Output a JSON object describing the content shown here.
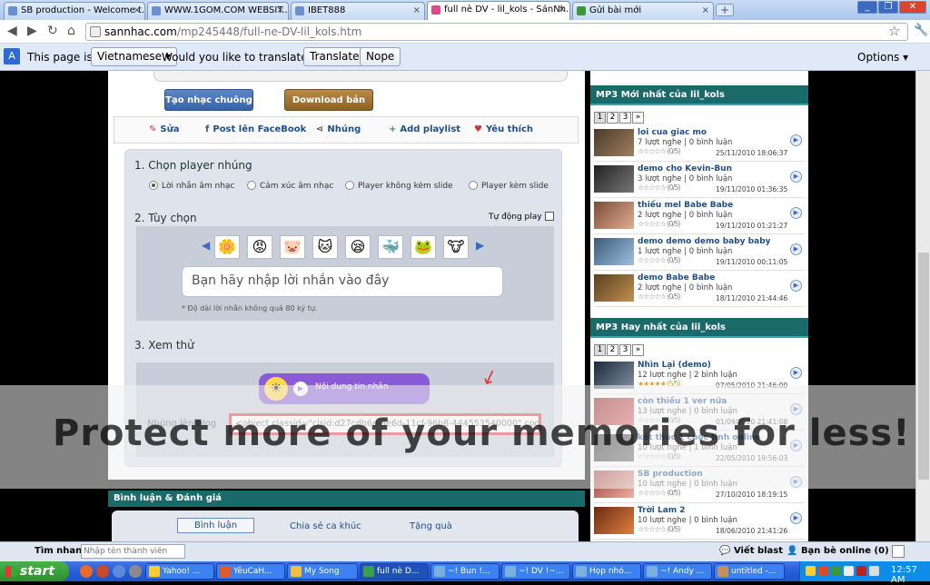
{
  "browser": {
    "tabs": [
      {
        "label": "SB production - Welcome t...",
        "active": false
      },
      {
        "label": "WWW.1GOM.COM WEBSIT...",
        "active": false
      },
      {
        "label": "IBET888",
        "active": false
      },
      {
        "label": "full nè DV - lil_kols - SánNh...",
        "active": true
      },
      {
        "label": "Gửi bài mới",
        "active": false
      }
    ],
    "url_host": "sannhac.com",
    "url_path": "/mp245448/full-ne-DV-lil_kols.htm"
  },
  "translate_bar": {
    "prefix": "This page is in",
    "language": "Vietnamese",
    "question": "Would you like to translate it?",
    "translate_btn": "Translate",
    "nope_btn": "Nope",
    "options": "Options"
  },
  "main": {
    "ringtone_btn": "Tạo nhạc chuông",
    "download_btn": "Download bản thu",
    "actions": {
      "edit": "Sửa",
      "facebook": "Post lên FaceBook",
      "embed": "Nhúng",
      "playlist": "Add playlist",
      "favorite": "Yêu thích"
    },
    "embed": {
      "section1": "1. Chọn player nhúng",
      "radios": [
        "Lời nhắn âm nhạc",
        "Cảm xúc âm nhạc",
        "Player không kèm slide",
        "Player kèm slide"
      ],
      "section2": "2. Tùy chọn",
      "autoplay": "Tự động play",
      "input_placeholder": "Bạn hãy nhập lời nhắn vào đây",
      "hint": "* Độ dài lời nhắn không quá 80 ký tự.",
      "section3": "3. Xem thử",
      "player_text": "Nội dung tin nhắn",
      "embed_label": "Nhúng lên blog",
      "embed_code": "<object classid=\"clsid:d27cdb6e-ae6d-11cf-96b8-444553540000\" codeb"
    },
    "comments_header": "Bình luận & Đánh giá",
    "comment_tabs": [
      "Bình luận",
      "Chia sẻ ca khúc",
      "Tặng quà"
    ]
  },
  "sidebar": {
    "latest_title": "MP3 Mới nhất của lil_kols",
    "best_title": "MP3 Hay nhất của lil_kols",
    "pages": [
      "1",
      "2",
      "3",
      "»"
    ],
    "latest": [
      {
        "title": "loi cua giac mo",
        "meta": "7 lượt nghe | 0 bình luận",
        "score": "(0/5)",
        "date": "25/11/2010 18:06:37"
      },
      {
        "title": "demo cho Kevin-Bun",
        "meta": "3 lượt nghe | 0 bình luận",
        "score": "(0/5)",
        "date": "19/11/2010 01:36:35"
      },
      {
        "title": "thiếu mel Babe Babe",
        "meta": "2 lượt nghe | 0 bình luận",
        "score": "(0/5)",
        "date": "19/11/2010 01:21:27"
      },
      {
        "title": "demo demo demo baby baby",
        "meta": "1 lượt nghe | 0 bình luận",
        "score": "(0/5)",
        "date": "19/11/2010 00:11:05"
      },
      {
        "title": "demo Babe Babe",
        "meta": "2 lượt nghe | 0 bình luận",
        "score": "(0/5)",
        "date": "18/11/2010 21:44:46"
      }
    ],
    "best": [
      {
        "title": "Nhìn Lại (demo)",
        "meta": "12 lượt nghe | 2 bình luận",
        "score": "(5/5)",
        "date": "07/05/2010 21:46:00"
      },
      {
        "title": "còn thiếu 1 ver nữa",
        "meta": "13 lượt nghe | 0 bình luận",
        "score": "(0/5)",
        "date": "01/09/2010 21:41:08"
      },
      {
        "title": "kết thúc 1 cuộc tình online",
        "meta": "10 lượt nghe | 1 bình luận",
        "score": "(0/5)",
        "date": "22/05/2010 19:56:03"
      },
      {
        "title": "SB production",
        "meta": "10 lượt nghe | 0 bình luận",
        "score": "(0/5)",
        "date": "27/10/2010 18:19:15"
      },
      {
        "title": "Trời Lam 2",
        "meta": "10 lượt nghe | 0 bình luận",
        "score": "(0/5)",
        "date": "18/06/2010 21:41:26"
      }
    ]
  },
  "watermark": "Protect more of your memories for less!",
  "statusbar": {
    "search_label": "Tìm nhanh:",
    "search_placeholder": "Nhập tên thành viên",
    "viet_blast": "Viết blast",
    "friends_online": "Bạn bè online (0)"
  },
  "taskbar": {
    "start": "start",
    "tasks": [
      "Yahoo! ...",
      "YêuCaH...",
      "My Song",
      "full nè D...",
      "~! Bun !...",
      "~! DV !~...",
      "Họp nhó...",
      "~! Andy ...",
      "untitled -..."
    ],
    "clock": "12:57 AM"
  }
}
